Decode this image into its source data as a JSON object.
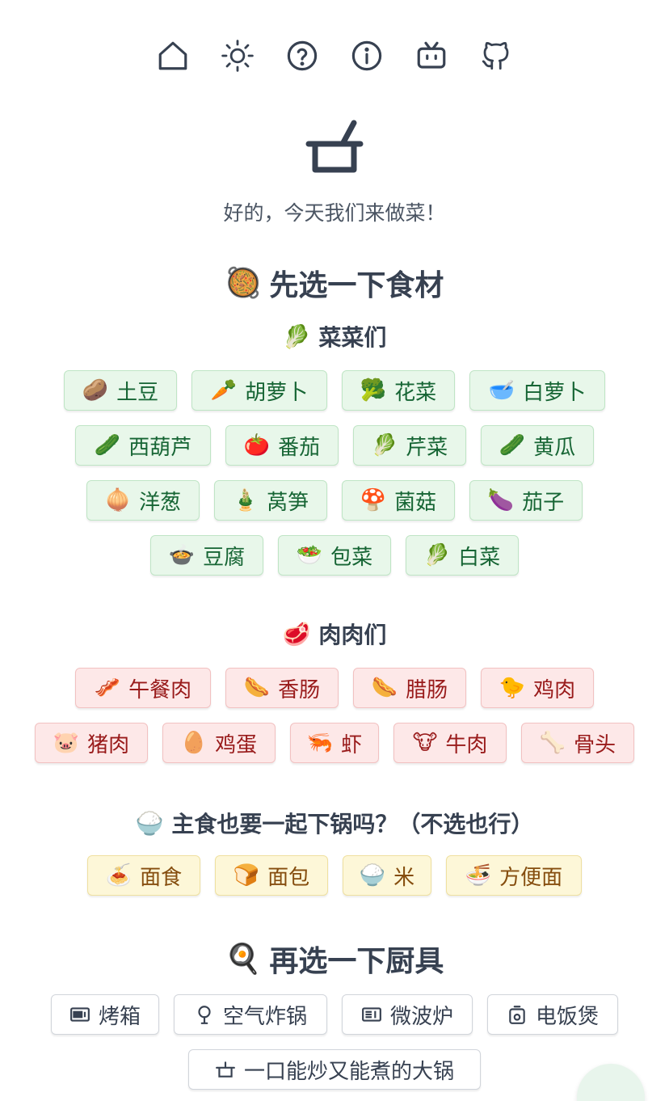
{
  "tagline": "好的，今天我们来做菜！",
  "nav": [
    {
      "icon": "home-icon"
    },
    {
      "icon": "sun-icon"
    },
    {
      "icon": "help-icon"
    },
    {
      "icon": "info-icon"
    },
    {
      "icon": "bilibili-icon"
    },
    {
      "icon": "github-icon"
    }
  ],
  "sections": {
    "ingredients": {
      "emoji": "🥘",
      "title": "先选一下食材"
    },
    "vegetables": {
      "emoji": "🥬",
      "title": "菜菜们"
    },
    "meats": {
      "emoji": "🥩",
      "title": "肉肉们"
    },
    "staples": {
      "emoji": "🍚",
      "title": "主食也要一起下锅吗？（不选也行）"
    },
    "tools": {
      "emoji": "🍳",
      "title": "再选一下厨具"
    }
  },
  "vegetables": [
    {
      "emoji": "🥔",
      "label": "土豆"
    },
    {
      "emoji": "🥕",
      "label": "胡萝卜"
    },
    {
      "emoji": "🥦",
      "label": "花菜"
    },
    {
      "emoji": "🥣",
      "label": "白萝卜"
    },
    {
      "emoji": "🥒",
      "label": "西葫芦"
    },
    {
      "emoji": "🍅",
      "label": "番茄"
    },
    {
      "emoji": "🥬",
      "label": "芹菜"
    },
    {
      "emoji": "🥒",
      "label": "黄瓜"
    },
    {
      "emoji": "🧅",
      "label": "洋葱"
    },
    {
      "emoji": "🎍",
      "label": "莴笋"
    },
    {
      "emoji": "🍄",
      "label": "菌菇"
    },
    {
      "emoji": "🍆",
      "label": "茄子"
    },
    {
      "emoji": "🍲",
      "label": "豆腐"
    },
    {
      "emoji": "🥗",
      "label": "包菜"
    },
    {
      "emoji": "🥬",
      "label": "白菜"
    }
  ],
  "meats": [
    {
      "emoji": "🥓",
      "label": "午餐肉"
    },
    {
      "emoji": "🌭",
      "label": "香肠"
    },
    {
      "emoji": "🌭",
      "label": "腊肠"
    },
    {
      "emoji": "🐤",
      "label": "鸡肉"
    },
    {
      "emoji": "🐷",
      "label": "猪肉"
    },
    {
      "emoji": "🥚",
      "label": "鸡蛋"
    },
    {
      "emoji": "🦐",
      "label": "虾"
    },
    {
      "emoji": "🐮",
      "label": "牛肉"
    },
    {
      "emoji": "🦴",
      "label": "骨头"
    }
  ],
  "staples": [
    {
      "emoji": "🍝",
      "label": "面食"
    },
    {
      "emoji": "🍞",
      "label": "面包"
    },
    {
      "emoji": "🍚",
      "label": "米"
    },
    {
      "emoji": "🍜",
      "label": "方便面"
    }
  ],
  "tools": [
    {
      "icon": "oven-icon",
      "label": "烤箱"
    },
    {
      "icon": "air-fryer-icon",
      "label": "空气炸锅"
    },
    {
      "icon": "microwave-icon",
      "label": "微波炉"
    },
    {
      "icon": "rice-cooker-icon",
      "label": "电饭煲"
    },
    {
      "icon": "pot-icon",
      "label": "一口能炒又能煮的大锅"
    }
  ]
}
